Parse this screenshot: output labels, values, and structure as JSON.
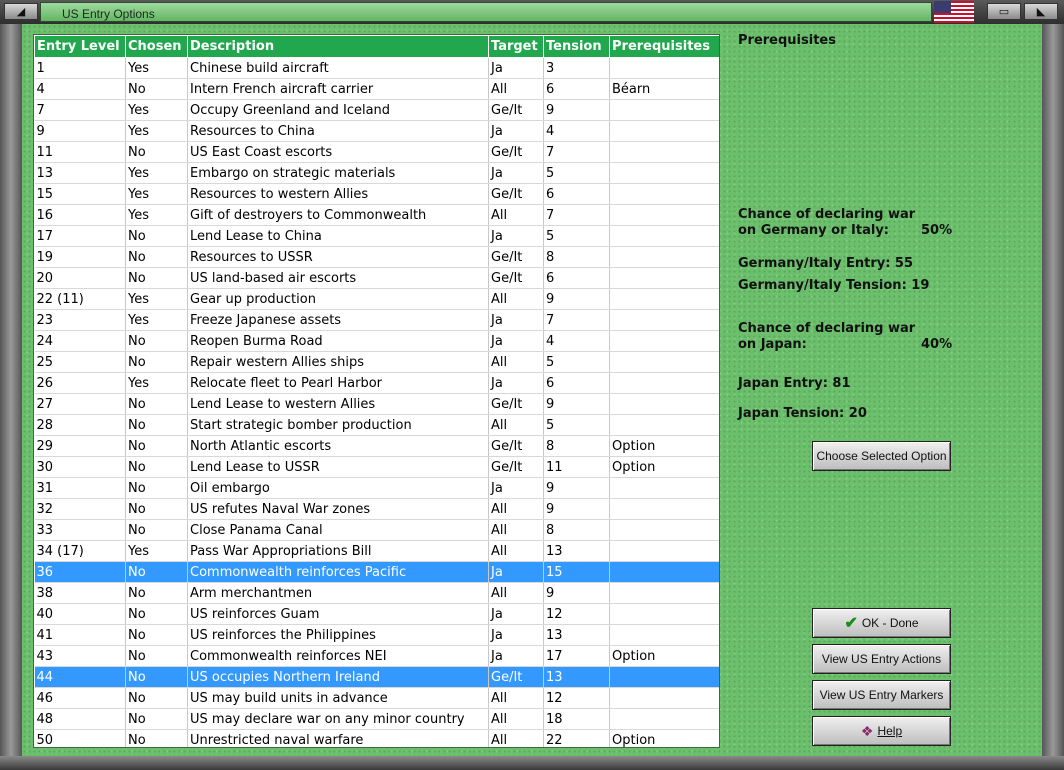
{
  "window": {
    "title": "US Entry Options"
  },
  "table": {
    "headers": [
      "Entry Level",
      "Chosen",
      "Description",
      "Target",
      "Tension",
      "Prerequisites"
    ],
    "rows": [
      {
        "level": "1",
        "chosen": "Yes",
        "description": "Chinese build aircraft",
        "target": "Ja",
        "tension": "3",
        "prereq": ""
      },
      {
        "level": "4",
        "chosen": "No",
        "description": "Intern French aircraft carrier",
        "target": "All",
        "tension": "6",
        "prereq": "Béarn"
      },
      {
        "level": "7",
        "chosen": "Yes",
        "description": "Occupy Greenland and Iceland",
        "target": "Ge/It",
        "tension": "9",
        "prereq": ""
      },
      {
        "level": "9",
        "chosen": "Yes",
        "description": "Resources to China",
        "target": "Ja",
        "tension": "4",
        "prereq": ""
      },
      {
        "level": "11",
        "chosen": "No",
        "description": "US East Coast escorts",
        "target": "Ge/It",
        "tension": "7",
        "prereq": ""
      },
      {
        "level": "13",
        "chosen": "Yes",
        "description": "Embargo on strategic materials",
        "target": "Ja",
        "tension": "5",
        "prereq": ""
      },
      {
        "level": "15",
        "chosen": "Yes",
        "description": "Resources to western Allies",
        "target": "Ge/It",
        "tension": "6",
        "prereq": ""
      },
      {
        "level": "16",
        "chosen": "Yes",
        "description": "Gift of destroyers to Commonwealth",
        "target": "All",
        "tension": "7",
        "prereq": ""
      },
      {
        "level": "17",
        "chosen": "No",
        "description": "Lend Lease to China",
        "target": "Ja",
        "tension": "5",
        "prereq": ""
      },
      {
        "level": "19",
        "chosen": "No",
        "description": "Resources to USSR",
        "target": "Ge/It",
        "tension": "8",
        "prereq": ""
      },
      {
        "level": "20",
        "chosen": "No",
        "description": "US land-based air escorts",
        "target": "Ge/It",
        "tension": "6",
        "prereq": ""
      },
      {
        "level": "22 (11)",
        "chosen": "Yes",
        "description": "Gear up production",
        "target": "All",
        "tension": "9",
        "prereq": ""
      },
      {
        "level": "23",
        "chosen": "Yes",
        "description": "Freeze Japanese assets",
        "target": "Ja",
        "tension": "7",
        "prereq": ""
      },
      {
        "level": "24",
        "chosen": "No",
        "description": "Reopen Burma Road",
        "target": "Ja",
        "tension": "4",
        "prereq": ""
      },
      {
        "level": "25",
        "chosen": "No",
        "description": "Repair western Allies ships",
        "target": "All",
        "tension": "5",
        "prereq": ""
      },
      {
        "level": "26",
        "chosen": "Yes",
        "description": "Relocate fleet to Pearl Harbor",
        "target": "Ja",
        "tension": "6",
        "prereq": ""
      },
      {
        "level": "27",
        "chosen": "No",
        "description": "Lend Lease to western Allies",
        "target": "Ge/It",
        "tension": "9",
        "prereq": ""
      },
      {
        "level": "28",
        "chosen": "No",
        "description": "Start strategic bomber production",
        "target": "All",
        "tension": "5",
        "prereq": ""
      },
      {
        "level": "29",
        "chosen": "No",
        "description": "North Atlantic escorts",
        "target": "Ge/It",
        "tension": "8",
        "prereq": "Option"
      },
      {
        "level": "30",
        "chosen": "No",
        "description": "Lend Lease to USSR",
        "target": "Ge/It",
        "tension": "11",
        "prereq": "Option"
      },
      {
        "level": "31",
        "chosen": "No",
        "description": "Oil embargo",
        "target": "Ja",
        "tension": "9",
        "prereq": ""
      },
      {
        "level": "32",
        "chosen": "No",
        "description": "US refutes Naval War zones",
        "target": "All",
        "tension": "9",
        "prereq": ""
      },
      {
        "level": "33",
        "chosen": "No",
        "description": "Close Panama Canal",
        "target": "All",
        "tension": "8",
        "prereq": ""
      },
      {
        "level": "34 (17)",
        "chosen": "Yes",
        "description": "Pass War Appropriations Bill",
        "target": "All",
        "tension": "13",
        "prereq": ""
      },
      {
        "level": "36",
        "chosen": "No",
        "description": "Commonwealth reinforces Pacific",
        "target": "Ja",
        "tension": "15",
        "prereq": "",
        "selected": true
      },
      {
        "level": "38",
        "chosen": "No",
        "description": "Arm merchantmen",
        "target": "All",
        "tension": "9",
        "prereq": ""
      },
      {
        "level": "40",
        "chosen": "No",
        "description": "US reinforces Guam",
        "target": "Ja",
        "tension": "12",
        "prereq": ""
      },
      {
        "level": "41",
        "chosen": "No",
        "description": "US reinforces the Philippines",
        "target": "Ja",
        "tension": "13",
        "prereq": ""
      },
      {
        "level": "43",
        "chosen": "No",
        "description": "Commonwealth reinforces NEI",
        "target": "Ja",
        "tension": "17",
        "prereq": "Option"
      },
      {
        "level": "44",
        "chosen": "No",
        "description": "US occupies Northern Ireland",
        "target": "Ge/It",
        "tension": "13",
        "prereq": "",
        "selected": true
      },
      {
        "level": "46",
        "chosen": "No",
        "description": "US may build units in advance",
        "target": "All",
        "tension": "12",
        "prereq": ""
      },
      {
        "level": "48",
        "chosen": "No",
        "description": "US may declare war on any minor country",
        "target": "All",
        "tension": "18",
        "prereq": ""
      },
      {
        "level": "50",
        "chosen": "No",
        "description": "Unrestricted naval warfare",
        "target": "All",
        "tension": "22",
        "prereq": "Option"
      }
    ]
  },
  "panel": {
    "prereq_heading": "Prerequisites",
    "germany_chance_line1": "Chance of declaring war",
    "germany_chance_line2": "on Germany or Italy:",
    "germany_chance_value": "50%",
    "germany_entry": "Germany/Italy Entry: 55",
    "germany_tension": "Germany/Italy Tension: 19",
    "japan_chance_line1": "Chance of declaring war",
    "japan_chance_line2": "on Japan:",
    "japan_chance_value": "40%",
    "japan_entry": "Japan Entry: 81",
    "japan_tension": "Japan Tension: 20"
  },
  "buttons": {
    "choose": "Choose Selected Option",
    "ok": "OK - Done",
    "view_actions": "View US Entry Actions",
    "view_markers": "View US Entry Markers",
    "help": "Help"
  },
  "colors": {
    "header_bg": "#21a84e",
    "selected_row": "#3399ff",
    "panel_bg": "#6cbf6c"
  }
}
